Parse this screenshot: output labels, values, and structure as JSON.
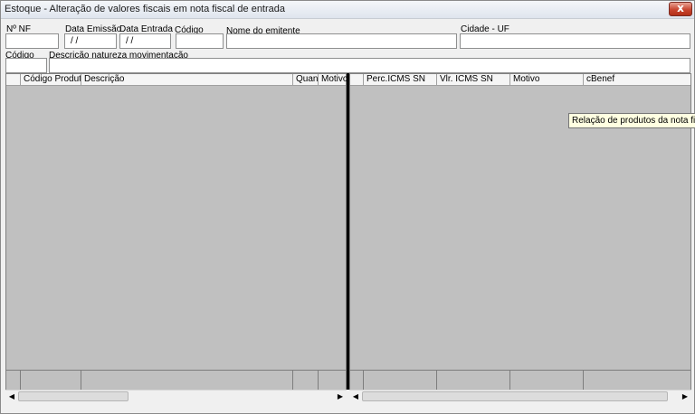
{
  "window": {
    "title": "Estoque - Alteração de valores fiscais em nota fiscal de entrada",
    "close_label": "x"
  },
  "header_fields": {
    "nf": {
      "label": "Nº NF",
      "value": ""
    },
    "data_emissao": {
      "label": "Data Emissão",
      "value": " / /"
    },
    "data_entrada": {
      "label": "Data Entrada",
      "value": " / /"
    },
    "codigo": {
      "label": "Código",
      "value": ""
    },
    "nome_emitente": {
      "label": "Nome do emitente",
      "value": ""
    },
    "cidade_uf": {
      "label": "Cidade - UF",
      "value": ""
    },
    "codigo_natureza": {
      "label": "Código",
      "value": ""
    },
    "descricao_natureza": {
      "label": "Descrição natureza movimentação",
      "value": ""
    }
  },
  "left_grid": {
    "columns": [
      "",
      "Código Produto",
      "Descrição",
      "Quant",
      "Motivo"
    ]
  },
  "right_grid": {
    "columns": [
      "",
      "Perc.ICMS SN",
      "Vlr. ICMS SN",
      "Motivo",
      "cBenef"
    ]
  },
  "tooltip": "Relação de produtos da nota fiscal",
  "icons": {
    "scroll_left": "left-arrow-icon",
    "scroll_right": "right-arrow-icon",
    "close": "close-icon"
  }
}
